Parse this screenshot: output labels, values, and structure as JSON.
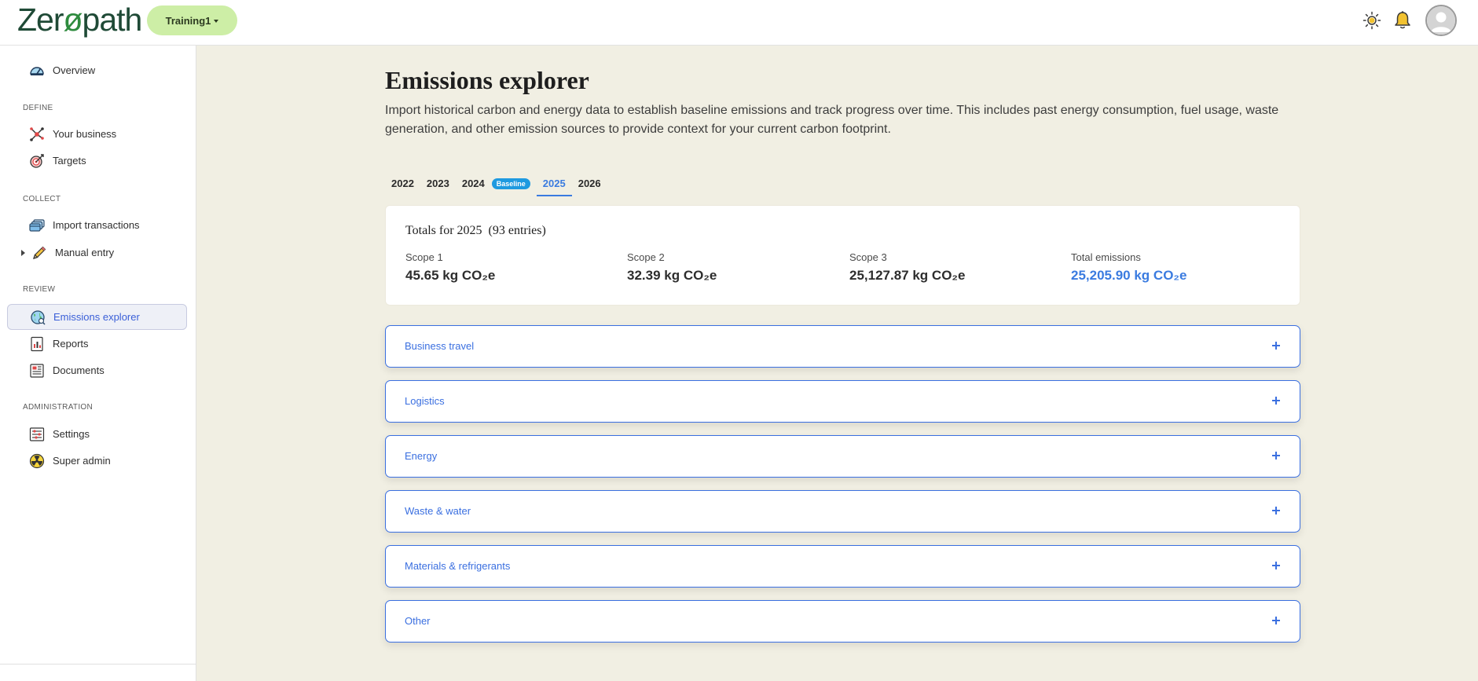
{
  "header": {
    "logo_prefix": "Zer",
    "logo_o": "ø",
    "logo_suffix": "path",
    "org_label": "Training1",
    "icons": [
      "sun-icon",
      "bell-icon",
      "user-avatar"
    ]
  },
  "sidebar": {
    "overview": "Overview",
    "sections": {
      "define": "DEFINE",
      "collect": "COLLECT",
      "review": "REVIEW",
      "administration": "ADMINISTRATION"
    },
    "items": {
      "your_business": "Your business",
      "targets": "Targets",
      "import_transactions": "Import transactions",
      "manual_entry": "Manual entry",
      "emissions_explorer": "Emissions explorer",
      "reports": "Reports",
      "documents": "Documents",
      "settings": "Settings",
      "super_admin": "Super admin"
    }
  },
  "main": {
    "title": "Emissions explorer",
    "description": "Import historical carbon and energy data to establish baseline emissions and track progress over time. This includes past energy consumption, fuel usage, waste generation, and other emission sources to provide context for your current carbon footprint.",
    "tabs": [
      {
        "label": "2022"
      },
      {
        "label": "2023"
      },
      {
        "label": "2024",
        "badge": "Baseline"
      },
      {
        "label": "2025",
        "active": true
      },
      {
        "label": "2026"
      }
    ],
    "totals": {
      "title": "Totals for 2025  (93 entries)",
      "scope1_label": "Scope 1",
      "scope1_value": "45.65 kg CO₂e",
      "scope2_label": "Scope 2",
      "scope2_value": "32.39 kg CO₂e",
      "scope3_label": "Scope 3",
      "scope3_value": "25,127.87 kg CO₂e",
      "total_label": "Total emissions",
      "total_value": "25,205.90 kg CO₂e"
    },
    "categories": [
      "Business travel",
      "Logistics",
      "Energy",
      "Waste & water",
      "Materials & refrigerants",
      "Other"
    ]
  },
  "colors": {
    "accent": "#3a7be0",
    "background": "#f1efe3",
    "org_button": "#cdeea6",
    "badge": "#1e9ae0"
  }
}
